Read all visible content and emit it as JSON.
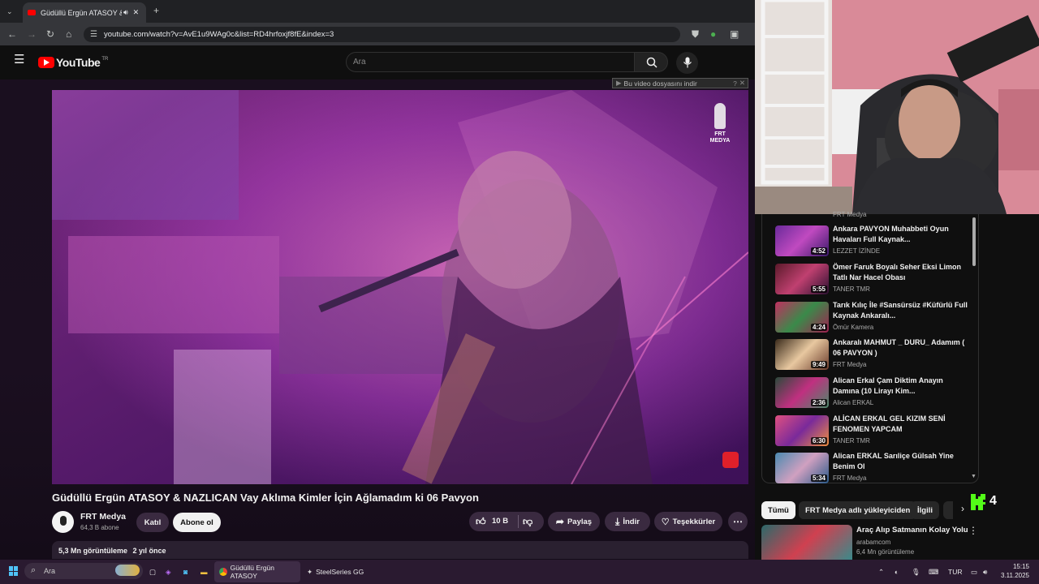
{
  "browser": {
    "tab_title": "Güdüllü Ergün ATASOY & N",
    "url": "youtube.com/watch?v=AvE1u9WAg0c&list=RD4hrfoxjf8fE&index=3"
  },
  "youtube": {
    "logo_text": "YouTube",
    "region": "TR",
    "search_placeholder": "Ara"
  },
  "video": {
    "download_bar": "Bu video dosyasını indir",
    "watermark": "FRT MEDYA",
    "title": "Güdüllü Ergün ATASOY & NAZLICAN Vay Aklıma Kimler İçin Ağlamadım ki 06 Pavyon",
    "channel": "FRT Medya",
    "subscribers": "64,3 B abone",
    "join_label": "Katıl",
    "subscribe_label": "Abone ol",
    "likes": "10 B",
    "share_label": "Paylaş",
    "download_label": "İndir",
    "thanks_label": "Teşekkürler",
    "views": "5,3 Mn görüntüleme",
    "age": "2 yıl önce"
  },
  "playlist": {
    "partial_channel": "FRT Medya",
    "items": [
      {
        "title": "Ankara PAVYON Muhabbeti Oyun Havaları Full Kaynak...",
        "channel": "LEZZET İZİNDE",
        "duration": "4:52"
      },
      {
        "title": "Ömer Faruk Boyalı Seher Eksi Limon Tatlı Nar Hacel Obası",
        "channel": "TANER TMR",
        "duration": "5:55"
      },
      {
        "title": "Tarık Kılıç İle #Sansürsüz #Küfürlü Full Kaynak Ankaralı...",
        "channel": "Ömür Kamera",
        "duration": "4:24"
      },
      {
        "title": "Ankaralı MAHMUT _ DURU_ Adamım ( 06 PAVYON )",
        "channel": "FRT Medya",
        "duration": "9:49"
      },
      {
        "title": "Alican Erkal Çam Diktim Anayın Damına (10 Lirayı Kim...",
        "channel": "Alican ERKAL",
        "duration": "2:36"
      },
      {
        "title": "ALİCAN ERKAL GEL KIZIM SENİ FENOMEN YAPCAM",
        "channel": "TANER TMR",
        "duration": "6:30"
      },
      {
        "title": "Alican ERKAL Sarıliçe Gülsah Yine Benim Ol",
        "channel": "FRT Medya",
        "duration": "5:34"
      }
    ]
  },
  "chips": [
    "Tümü",
    "FRT Medya adlı yükleyiciden",
    "İlgili"
  ],
  "kick_count": "4",
  "recommended": {
    "title": "Araç Alıp Satmanın Kolay Yolu",
    "channel": "arabamcom",
    "views": "6,4 Mn görüntüleme"
  },
  "taskbar": {
    "search_placeholder": "Ara",
    "apps": [
      "Güdüllü Ergün ATASOY",
      "SteelSeries GG"
    ],
    "language": "TUR",
    "time": "15:15",
    "date": "3.11.2025"
  },
  "colors": {
    "accent_red": "#ff0000",
    "kick_green": "#53fc18",
    "video_magenta": "#c040b0",
    "taskbar_bg": "#2a1a30"
  }
}
